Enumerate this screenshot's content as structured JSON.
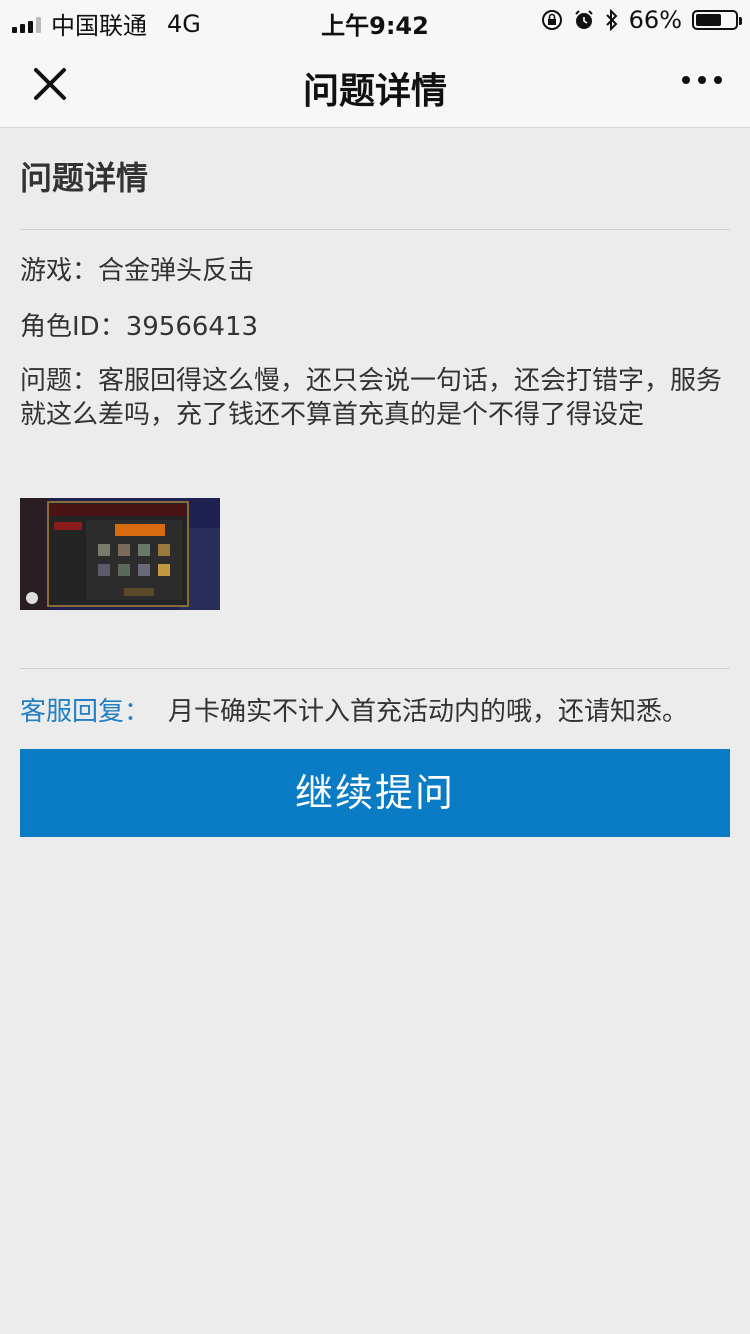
{
  "status_bar": {
    "carrier": "中国联通",
    "network": "4G",
    "time": "上午9:42",
    "battery": "66%",
    "battery_level": 0.66,
    "icons": [
      "signal-icon",
      "rotation-lock-icon",
      "alarm-icon",
      "bluetooth-icon",
      "battery-icon"
    ]
  },
  "nav": {
    "title": "问题详情",
    "close_icon": "close-icon",
    "more_icon": "more-icon"
  },
  "main": {
    "section_title": "问题详情",
    "game_line": "游戏：合金弹头反击",
    "role_line": "角色ID：39566413",
    "problem_line": "问题：客服回得这么慢，还只会说一句话，还会打错字，服务就这么差吗，充了钱还不算首充真的是个不得了得设定",
    "reply_label": "客服回复：",
    "reply_text": "月卡确实不计入首充活动内的哦，还请知悉。",
    "continue_button": "继续提问"
  },
  "colors": {
    "accent": "#0a7cc6",
    "reply_label": "#2280c4",
    "background": "#ececec"
  }
}
